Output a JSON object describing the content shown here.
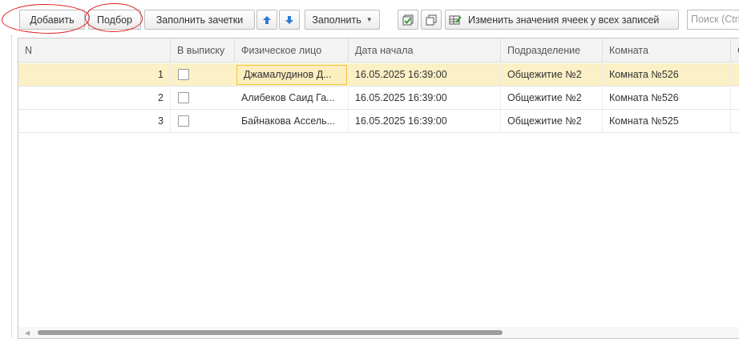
{
  "toolbar": {
    "add_label": "Добавить",
    "pick_label": "Подбор",
    "fill_gradebooks_label": "Заполнить зачетки",
    "move_up_icon": "arrow-up-icon",
    "move_down_icon": "arrow-down-icon",
    "fill_label": "Заполнить",
    "check_all_icon": "check-all-icon",
    "copy_icon": "copy-icon",
    "change_values_label": "Изменить значения ячеек у всех записей",
    "search_placeholder": "Поиск (Ctrl"
  },
  "table": {
    "columns": [
      "N",
      "В выписку",
      "Физическое лицо",
      "Дата начала",
      "Подразделение",
      "Комната",
      "С"
    ],
    "rows": [
      {
        "n": "1",
        "checked": false,
        "person": "Джамалудинов Д...",
        "start": "16.05.2025 16:39:00",
        "dept": "Общежитие №2",
        "room": "Комната №526",
        "selected": true
      },
      {
        "n": "2",
        "checked": false,
        "person": "Алибеков Саид Га...",
        "start": "16.05.2025 16:39:00",
        "dept": "Общежитие №2",
        "room": "Комната №526",
        "selected": false
      },
      {
        "n": "3",
        "checked": false,
        "person": "Байнакова Ассель...",
        "start": "16.05.2025 16:39:00",
        "dept": "Общежитие №2",
        "room": "Комната №525",
        "selected": false
      }
    ]
  },
  "colors": {
    "selected_row": "#fbf0c6",
    "active_cell_border": "#f0c43a",
    "annotation_red": "#e01c1c",
    "arrow_blue": "#2e7bd6"
  }
}
